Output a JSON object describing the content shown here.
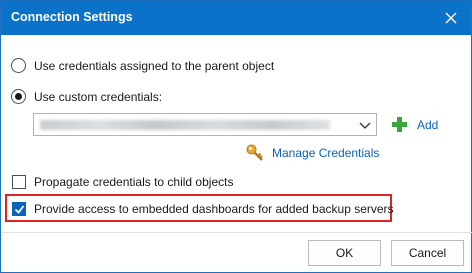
{
  "dialog": {
    "title": "Connection Settings",
    "close_icon": "close-icon"
  },
  "options": {
    "parent_credentials_label": "Use credentials assigned to the parent object",
    "parent_credentials_selected": false,
    "custom_credentials_label": "Use custom credentials:",
    "custom_credentials_selected": true,
    "credentials_select_value": "",
    "add_label": "Add",
    "add_icon": "plus-icon",
    "manage_credentials_label": "Manage Credentials",
    "manage_icon": "key-icon",
    "propagate_label": "Propagate credentials to child objects",
    "propagate_checked": false,
    "dashboards_label": "Provide access to embedded dashboards for added backup servers",
    "dashboards_checked": true
  },
  "footer": {
    "ok_label": "OK",
    "cancel_label": "Cancel"
  },
  "colors": {
    "titlebar": "#0b72c9",
    "link": "#0b63b6",
    "add_icon": "#3aa339",
    "highlight": "#e02424"
  }
}
